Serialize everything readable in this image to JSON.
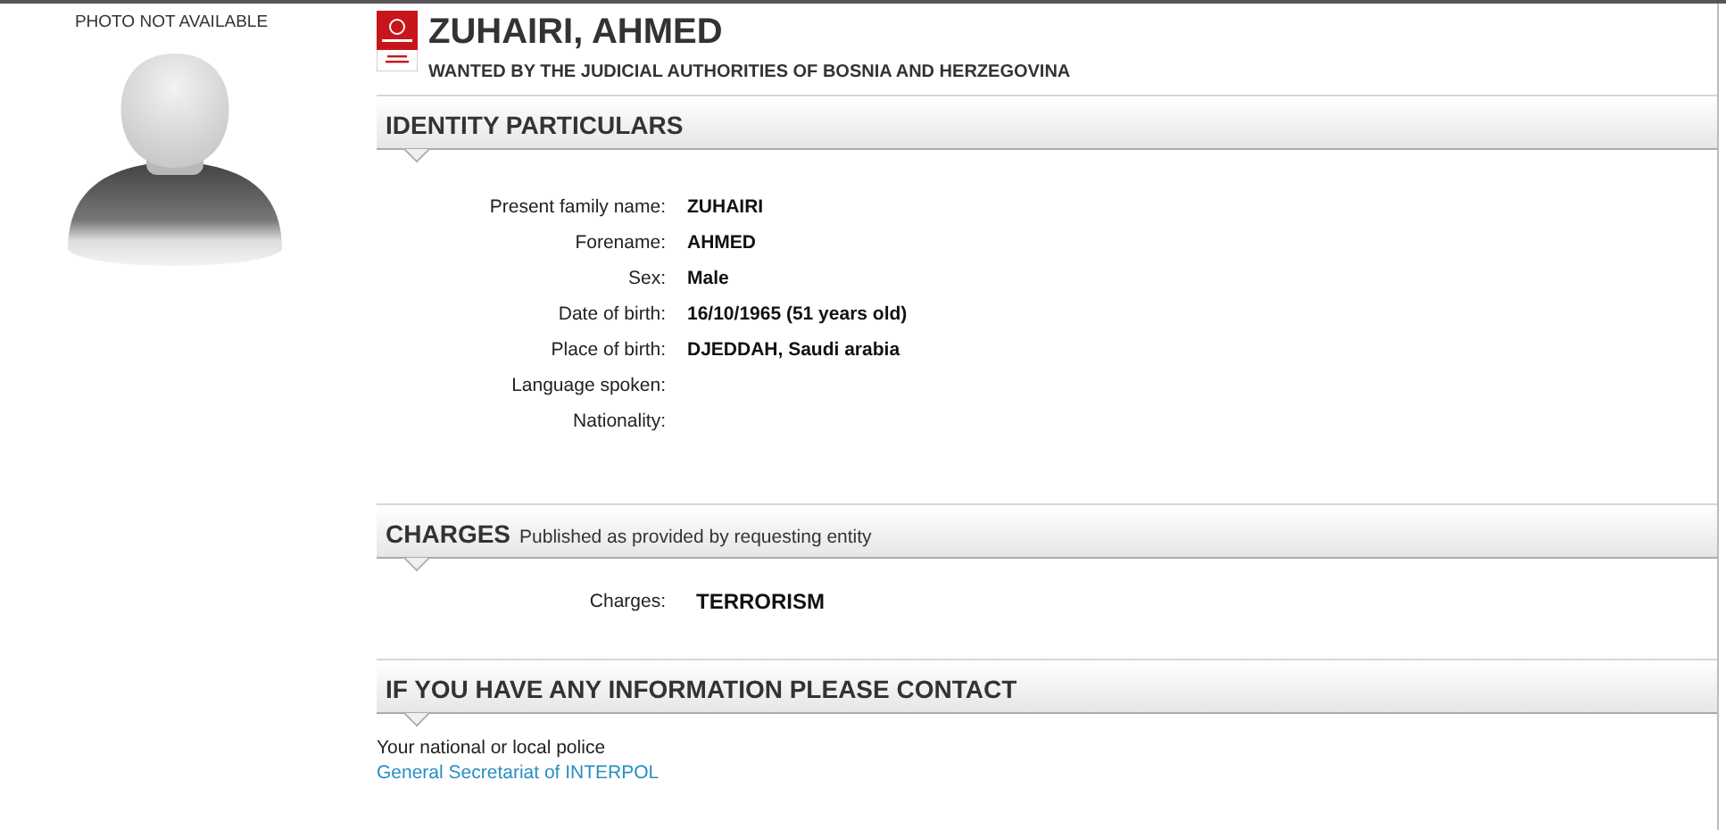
{
  "photo": {
    "caption": "PHOTO NOT AVAILABLE"
  },
  "notice": {
    "name": "ZUHAIRI, AHMED",
    "subtitle": "WANTED BY THE JUDICIAL AUTHORITIES OF BOSNIA AND HERZEGOVINA"
  },
  "identity": {
    "heading": "IDENTITY PARTICULARS",
    "fields": [
      {
        "label": "Present family name:",
        "value": "ZUHAIRI"
      },
      {
        "label": "Forename:",
        "value": "AHMED"
      },
      {
        "label": "Sex:",
        "value": "Male"
      },
      {
        "label": "Date of birth:",
        "value": "16/10/1965 (51 years old)"
      },
      {
        "label": "Place of birth:",
        "value": "DJEDDAH, Saudi arabia"
      },
      {
        "label": "Language spoken:"
      },
      {
        "label": "Nationality:"
      }
    ]
  },
  "charges": {
    "heading": "CHARGES",
    "note": "Published as provided by requesting entity",
    "label": "Charges:",
    "value": "TERRORISM"
  },
  "contact": {
    "heading": "IF YOU HAVE ANY INFORMATION PLEASE CONTACT",
    "lines": [
      {
        "text": "Your national or local police",
        "kind": "text"
      },
      {
        "text": "General Secretariat of INTERPOL",
        "kind": "link"
      }
    ]
  }
}
